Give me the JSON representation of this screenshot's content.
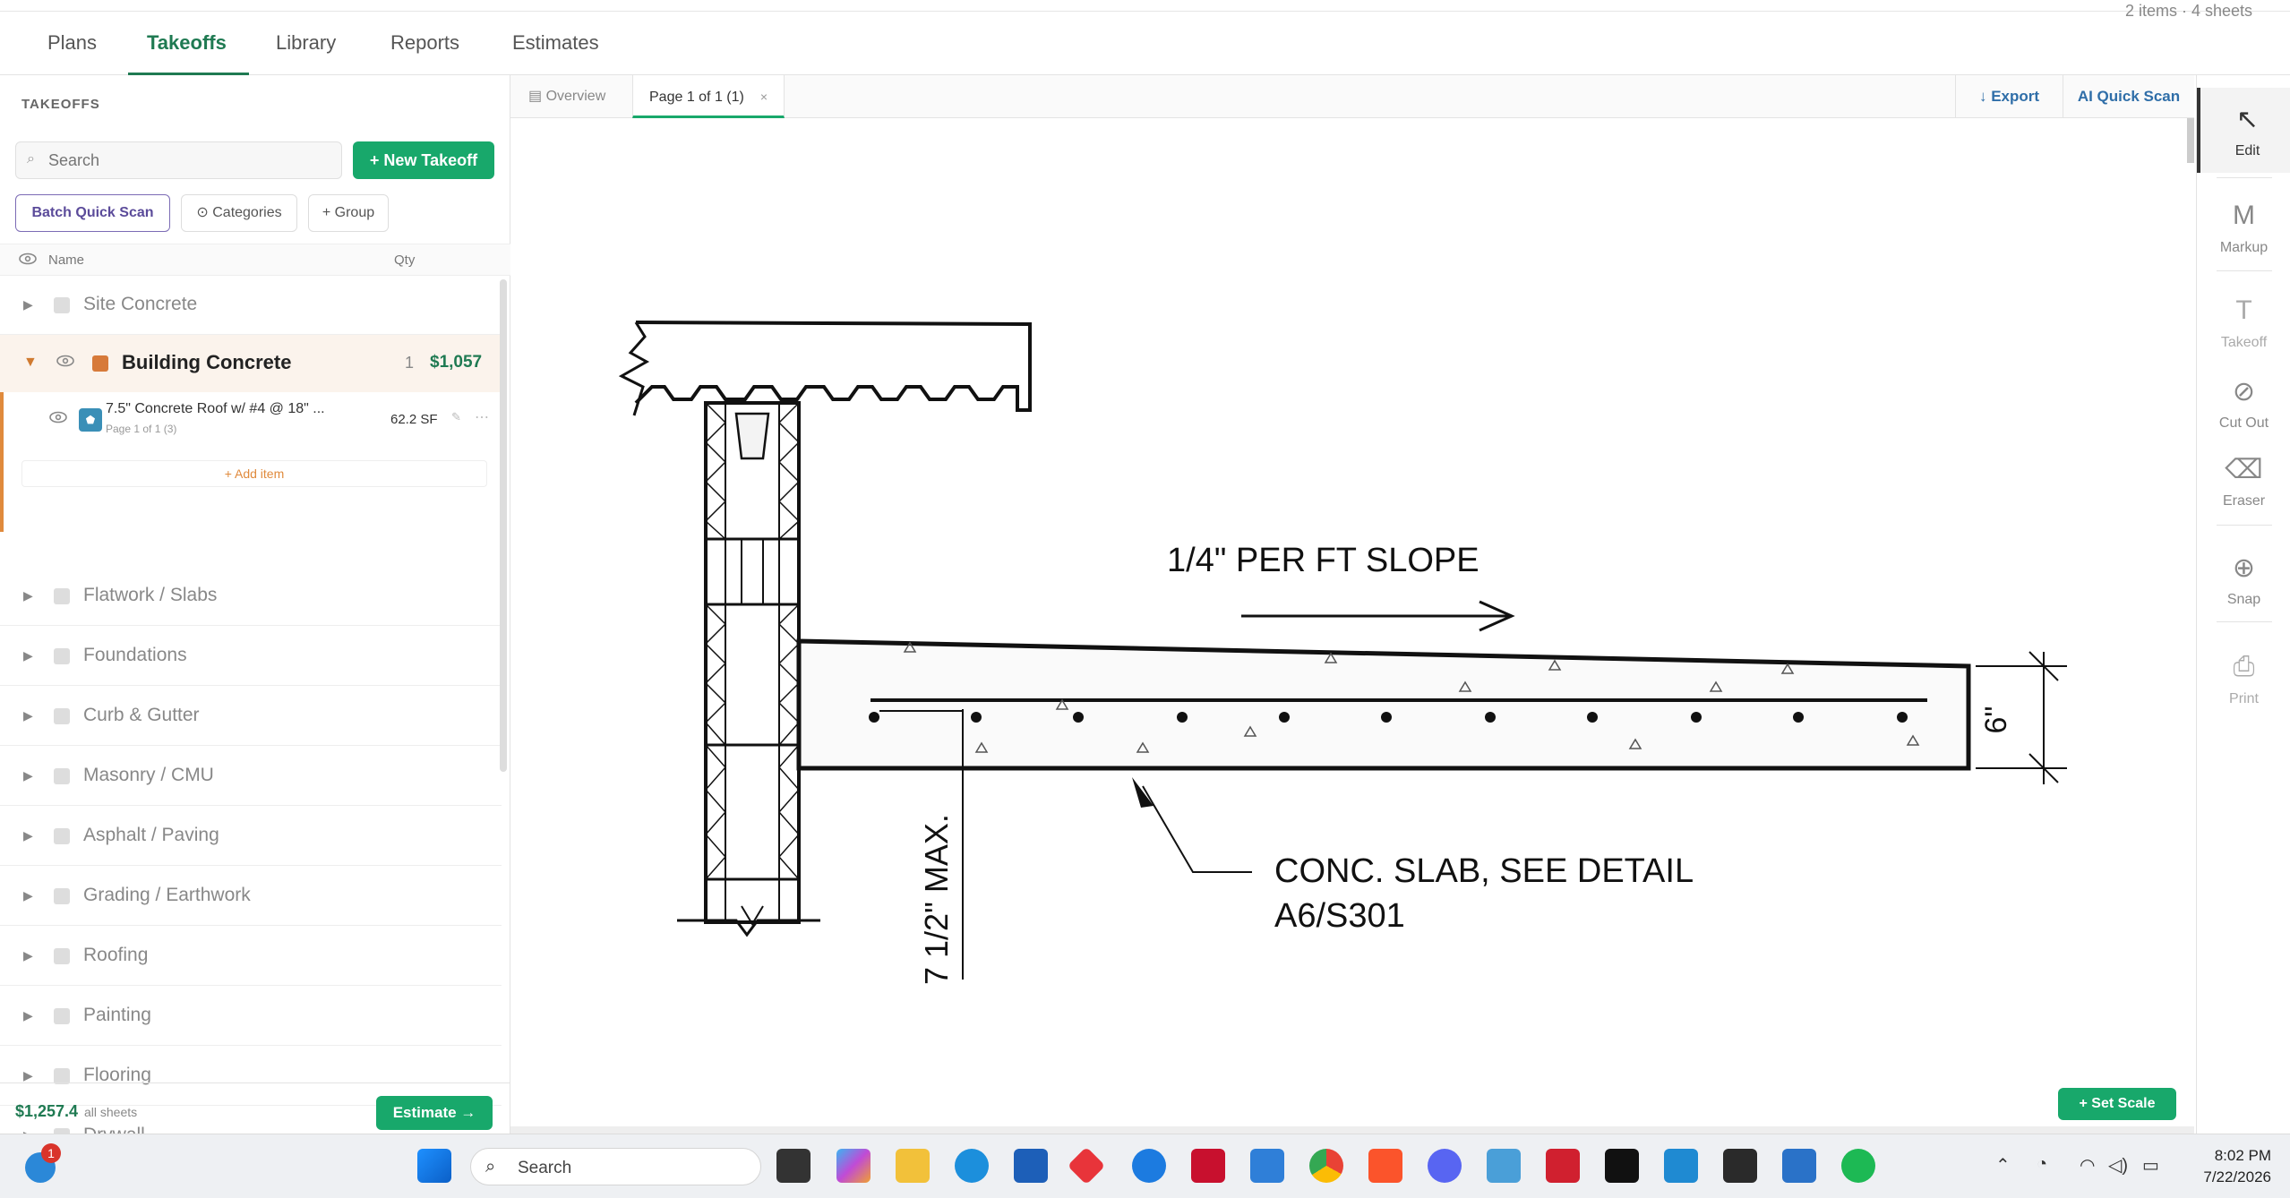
{
  "nav": {
    "tabs": [
      "Plans",
      "Takeoffs",
      "Library",
      "Reports",
      "Estimates"
    ],
    "meta": "2 items · 4 sheets"
  },
  "left": {
    "title": "TAKEOFFS",
    "search_placeholder": "Search",
    "new_takeoff": "+ New Takeoff",
    "batch": "Batch Quick Scan",
    "categories": "Categories",
    "group": "+ Group",
    "col_name": "Name",
    "col_qty": "Qty",
    "groups": [
      "Site Concrete",
      "Flatwork / Slabs",
      "Foundations",
      "Curb & Gutter",
      "Masonry / CMU",
      "Asphalt / Paving",
      "Grading / Earthwork",
      "Roofing",
      "Painting",
      "Flooring",
      "Drywall"
    ],
    "open_group": {
      "name": "Building Concrete",
      "count": "1",
      "cost": "$1,057",
      "item": {
        "name": "7.5\" Concrete Roof w/ #4 @ 18\" ...",
        "sub": "Page 1 of 1 (3)",
        "qty": "62.2 SF"
      },
      "add_item": "+ Add item"
    },
    "footer": {
      "total": "$1,257.4",
      "sub": "all sheets",
      "estimate": "Estimate →"
    }
  },
  "center": {
    "tab_overview": "Overview",
    "tab_page": "Page 1 of 1 (1)",
    "export": "↓ Export",
    "ai_scan": "AI Quick Scan",
    "set_scale": "+ Set Scale"
  },
  "drawing": {
    "slope_note": "1/4\" PER FT SLOPE",
    "slab_note_1": "CONC. SLAB, SEE DETAIL",
    "slab_note_2": "A6/S301",
    "dim_vertical": "7 1/2\" MAX.",
    "dim_thickness": "6\""
  },
  "tools": [
    {
      "glyph": "↖",
      "label": "Edit"
    },
    {
      "glyph": "M",
      "label": "Markup"
    },
    {
      "glyph": "T",
      "label": "Takeoff"
    },
    {
      "glyph": "⊘",
      "label": "Cut Out"
    },
    {
      "glyph": "⌫",
      "label": "Eraser"
    },
    {
      "glyph": "⊕",
      "label": "Snap"
    },
    {
      "glyph": "⎙",
      "label": "Print"
    }
  ],
  "taskbar": {
    "search": "Search",
    "time": "8:02 PM",
    "date": "7/22/2026",
    "notif_count": "1"
  },
  "colors": {
    "accent_green": "#18a86b",
    "accent_orange": "#d77a3a",
    "link_blue": "#2f6ea8"
  }
}
